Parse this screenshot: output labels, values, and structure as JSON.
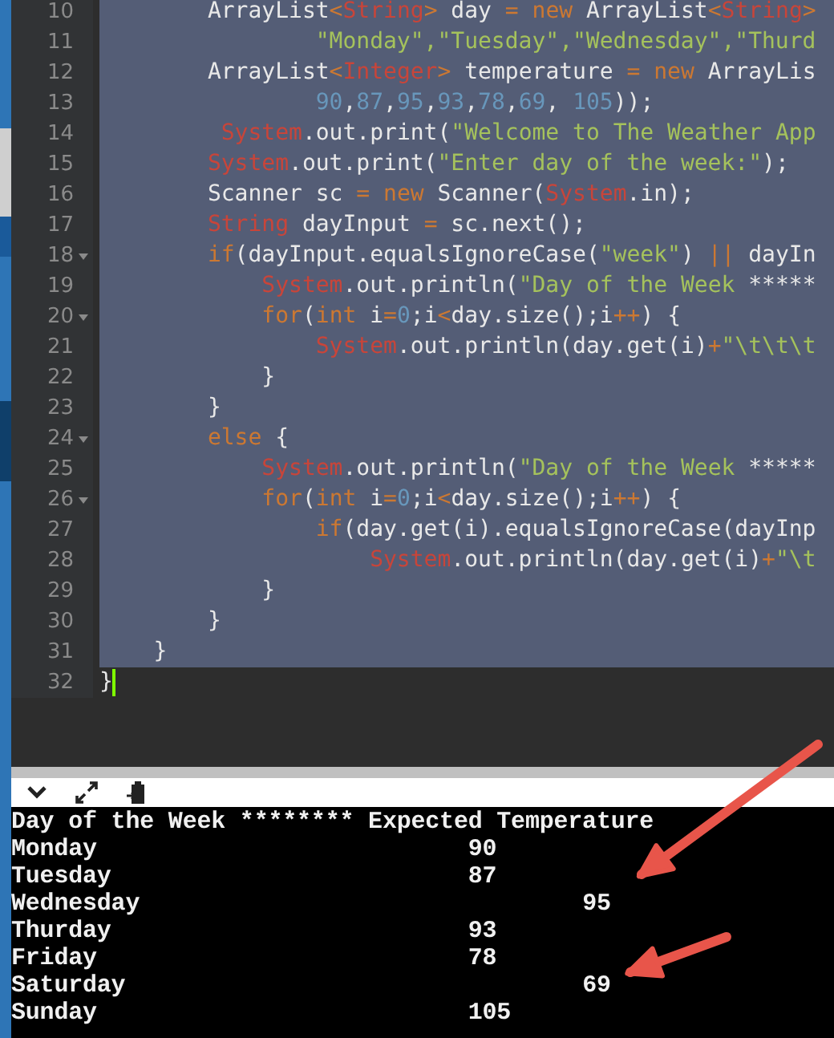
{
  "editor": {
    "lines": [
      {
        "n": "10",
        "selected": true,
        "foldable": false,
        "tokens": [
          {
            "kind": "plain",
            "text": "\t\tArrayList"
          },
          {
            "kind": "keyword",
            "text": "<"
          },
          {
            "kind": "type",
            "text": "String"
          },
          {
            "kind": "keyword",
            "text": ">"
          },
          {
            "kind": "plain",
            "text": " day "
          },
          {
            "kind": "keyword",
            "text": "="
          },
          {
            "kind": "keyword",
            "text": " new"
          },
          {
            "kind": "plain",
            "text": " ArrayList"
          },
          {
            "kind": "keyword",
            "text": "<"
          },
          {
            "kind": "type",
            "text": "String"
          },
          {
            "kind": "keyword",
            "text": ">"
          }
        ]
      },
      {
        "n": "11",
        "selected": true,
        "foldable": false,
        "tokens": [
          {
            "kind": "string",
            "text": "\t\t\t\t\"Monday\",\"Tuesday\",\"Wednesday\",\"Thurd"
          }
        ]
      },
      {
        "n": "12",
        "selected": true,
        "foldable": false,
        "tokens": [
          {
            "kind": "plain",
            "text": "\t\tArrayList"
          },
          {
            "kind": "keyword",
            "text": "<"
          },
          {
            "kind": "type",
            "text": "Integer"
          },
          {
            "kind": "keyword",
            "text": ">"
          },
          {
            "kind": "plain",
            "text": " temperature "
          },
          {
            "kind": "keyword",
            "text": "="
          },
          {
            "kind": "keyword",
            "text": " new"
          },
          {
            "kind": "plain",
            "text": " ArrayLis"
          }
        ]
      },
      {
        "n": "13",
        "selected": true,
        "foldable": false,
        "tokens": [
          {
            "kind": "number",
            "text": "\t\t\t\t90"
          },
          {
            "kind": "plain",
            "text": ","
          },
          {
            "kind": "number",
            "text": "87"
          },
          {
            "kind": "plain",
            "text": ","
          },
          {
            "kind": "number",
            "text": "95"
          },
          {
            "kind": "plain",
            "text": ","
          },
          {
            "kind": "number",
            "text": "93"
          },
          {
            "kind": "plain",
            "text": ","
          },
          {
            "kind": "number",
            "text": "78"
          },
          {
            "kind": "plain",
            "text": ","
          },
          {
            "kind": "number",
            "text": "69"
          },
          {
            "kind": "plain",
            "text": ","
          },
          {
            "kind": "number",
            "text": " 105"
          },
          {
            "kind": "plain",
            "text": "));"
          }
        ]
      },
      {
        "n": "14",
        "selected": true,
        "foldable": false,
        "tokens": [
          {
            "kind": "type",
            "text": "\t\t System"
          },
          {
            "kind": "plain",
            "text": ".out.print("
          },
          {
            "kind": "string",
            "text": "\"Welcome to The Weather App"
          }
        ]
      },
      {
        "n": "15",
        "selected": true,
        "foldable": false,
        "tokens": [
          {
            "kind": "type",
            "text": "\t\tSystem"
          },
          {
            "kind": "plain",
            "text": ".out.print("
          },
          {
            "kind": "string",
            "text": "\"Enter day of the week:\""
          },
          {
            "kind": "plain",
            "text": ");"
          }
        ]
      },
      {
        "n": "16",
        "selected": true,
        "foldable": false,
        "tokens": [
          {
            "kind": "plain",
            "text": "\t\tScanner sc "
          },
          {
            "kind": "keyword",
            "text": "="
          },
          {
            "kind": "keyword",
            "text": " new"
          },
          {
            "kind": "plain",
            "text": " Scanner("
          },
          {
            "kind": "type",
            "text": "System"
          },
          {
            "kind": "plain",
            "text": ".in);"
          }
        ]
      },
      {
        "n": "17",
        "selected": true,
        "foldable": false,
        "tokens": [
          {
            "kind": "type",
            "text": "\t\tString"
          },
          {
            "kind": "plain",
            "text": " dayInput "
          },
          {
            "kind": "keyword",
            "text": "="
          },
          {
            "kind": "plain",
            "text": " sc.next();"
          }
        ]
      },
      {
        "n": "18",
        "selected": true,
        "foldable": true,
        "tokens": [
          {
            "kind": "keyword",
            "text": "\t\tif"
          },
          {
            "kind": "plain",
            "text": "(dayInput.equalsIgnoreCase("
          },
          {
            "kind": "string",
            "text": "\"week\""
          },
          {
            "kind": "plain",
            "text": ") "
          },
          {
            "kind": "keyword",
            "text": "||"
          },
          {
            "kind": "plain",
            "text": " dayIn"
          }
        ]
      },
      {
        "n": "19",
        "selected": true,
        "foldable": false,
        "tokens": [
          {
            "kind": "type",
            "text": "\t\t\tSystem"
          },
          {
            "kind": "plain",
            "text": ".out.println("
          },
          {
            "kind": "string",
            "text": "\"Day of the Week "
          },
          {
            "kind": "plain",
            "text": "*****"
          }
        ]
      },
      {
        "n": "20",
        "selected": true,
        "foldable": true,
        "tokens": [
          {
            "kind": "keyword",
            "text": "\t\t\tfor"
          },
          {
            "kind": "plain",
            "text": "("
          },
          {
            "kind": "keyword",
            "text": "int"
          },
          {
            "kind": "plain",
            "text": " i"
          },
          {
            "kind": "keyword",
            "text": "="
          },
          {
            "kind": "number",
            "text": "0"
          },
          {
            "kind": "plain",
            "text": ";i"
          },
          {
            "kind": "keyword",
            "text": "<"
          },
          {
            "kind": "plain",
            "text": "day.size();i"
          },
          {
            "kind": "keyword",
            "text": "++"
          },
          {
            "kind": "plain",
            "text": ") {"
          }
        ]
      },
      {
        "n": "21",
        "selected": true,
        "foldable": false,
        "tokens": [
          {
            "kind": "type",
            "text": "\t\t\t\tSystem"
          },
          {
            "kind": "plain",
            "text": ".out.println(day.get(i)"
          },
          {
            "kind": "keyword",
            "text": "+"
          },
          {
            "kind": "string",
            "text": "\"\\t\\t\\t"
          }
        ]
      },
      {
        "n": "22",
        "selected": true,
        "foldable": false,
        "tokens": [
          {
            "kind": "plain",
            "text": "\t\t\t}"
          }
        ]
      },
      {
        "n": "23",
        "selected": true,
        "foldable": false,
        "tokens": [
          {
            "kind": "plain",
            "text": "\t\t}"
          }
        ]
      },
      {
        "n": "24",
        "selected": true,
        "foldable": true,
        "tokens": [
          {
            "kind": "keyword",
            "text": "\t\telse"
          },
          {
            "kind": "plain",
            "text": " {"
          }
        ]
      },
      {
        "n": "25",
        "selected": true,
        "foldable": false,
        "tokens": [
          {
            "kind": "type",
            "text": "\t\t\tSystem"
          },
          {
            "kind": "plain",
            "text": ".out.println("
          },
          {
            "kind": "string",
            "text": "\"Day of the Week "
          },
          {
            "kind": "plain",
            "text": "*****"
          }
        ]
      },
      {
        "n": "26",
        "selected": true,
        "foldable": true,
        "tokens": [
          {
            "kind": "keyword",
            "text": "\t\t\tfor"
          },
          {
            "kind": "plain",
            "text": "("
          },
          {
            "kind": "keyword",
            "text": "int"
          },
          {
            "kind": "plain",
            "text": " i"
          },
          {
            "kind": "keyword",
            "text": "="
          },
          {
            "kind": "number",
            "text": "0"
          },
          {
            "kind": "plain",
            "text": ";i"
          },
          {
            "kind": "keyword",
            "text": "<"
          },
          {
            "kind": "plain",
            "text": "day.size();i"
          },
          {
            "kind": "keyword",
            "text": "++"
          },
          {
            "kind": "plain",
            "text": ") {"
          }
        ]
      },
      {
        "n": "27",
        "selected": true,
        "foldable": false,
        "tokens": [
          {
            "kind": "keyword",
            "text": "\t\t\t\tif"
          },
          {
            "kind": "plain",
            "text": "(day.get(i).equalsIgnoreCase(dayInp"
          }
        ]
      },
      {
        "n": "28",
        "selected": true,
        "foldable": false,
        "tokens": [
          {
            "kind": "type",
            "text": "\t\t\t\t\tSystem"
          },
          {
            "kind": "plain",
            "text": ".out.println(day.get(i)"
          },
          {
            "kind": "keyword",
            "text": "+"
          },
          {
            "kind": "string",
            "text": "\"\\t"
          }
        ]
      },
      {
        "n": "29",
        "selected": true,
        "foldable": false,
        "tokens": [
          {
            "kind": "plain",
            "text": "\t\t\t}"
          }
        ]
      },
      {
        "n": "30",
        "selected": true,
        "foldable": false,
        "tokens": [
          {
            "kind": "plain",
            "text": "\t\t}"
          }
        ]
      },
      {
        "n": "31",
        "selected": true,
        "foldable": false,
        "tokens": [
          {
            "kind": "plain",
            "text": "\t}"
          }
        ]
      },
      {
        "n": "32",
        "selected": false,
        "foldable": false,
        "cursor": true,
        "tokens": [
          {
            "kind": "plain",
            "text": "}"
          }
        ]
      }
    ]
  },
  "console": {
    "toolbar": [
      {
        "kind": "chevron"
      },
      {
        "kind": "expand"
      },
      {
        "kind": "clipboard"
      }
    ],
    "lines": [
      "Day of the Week ******** Expected Temperature",
      "Monday\t\t\t\t90",
      "Tuesday\t\t\t\t87",
      "Wednesday\t\t\t\t95",
      "Thurday\t\t\t\t93",
      "Friday\t\t\t\t78",
      "Saturday\t\t\t\t69",
      "Sunday\t\t\t\t105"
    ]
  },
  "annotations": [
    {
      "kind": "arrow"
    },
    {
      "kind": "arrow"
    }
  ]
}
